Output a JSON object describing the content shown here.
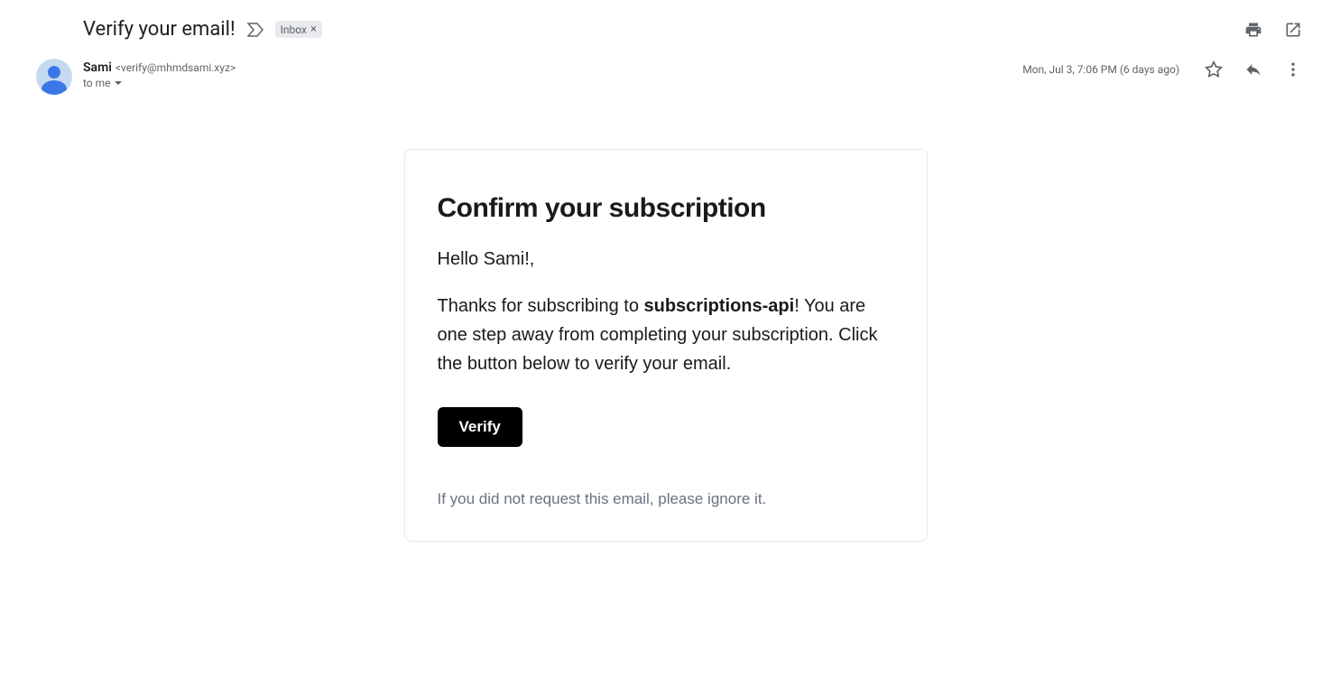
{
  "header": {
    "subject": "Verify your email!",
    "label": "Inbox"
  },
  "sender": {
    "name": "Sami",
    "email": "<verify@mhmdsami.xyz>",
    "recipient": "to me"
  },
  "meta": {
    "timestamp": "Mon, Jul 3, 7:06 PM (6 days ago)"
  },
  "email": {
    "title": "Confirm your subscription",
    "greeting": "Hello Sami!,",
    "body_prefix": "Thanks for subscribing to ",
    "body_bold": "subscriptions-api",
    "body_suffix": "! You are one step away from completing your subscription. Click the button below to verify your email.",
    "verify_label": "Verify",
    "disclaimer": "If you did not request this email, please ignore it."
  }
}
